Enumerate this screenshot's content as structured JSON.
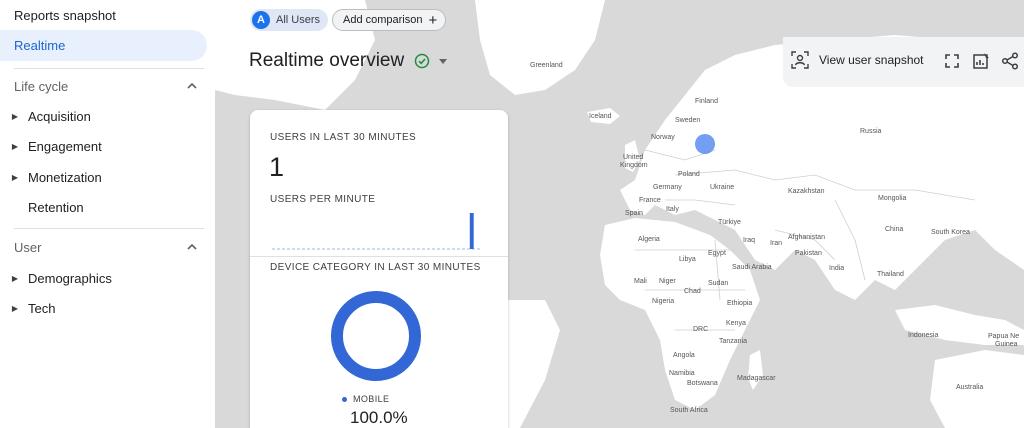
{
  "sidebar": {
    "reports_snapshot": "Reports snapshot",
    "realtime": "Realtime",
    "lifecycle": {
      "label": "Life cycle",
      "items": [
        "Acquisition",
        "Engagement",
        "Monetization",
        "Retention"
      ]
    },
    "user": {
      "label": "User",
      "items": [
        "Demographics",
        "Tech"
      ]
    }
  },
  "header": {
    "segment_badge": "A",
    "segment_label": "All Users",
    "add_comparison": "Add comparison",
    "title": "Realtime overview",
    "view_user_snapshot": "View user snapshot"
  },
  "card": {
    "users_label": "USERS IN LAST 30 MINUTES",
    "users_value": "1",
    "per_minute_label": "USERS PER MINUTE",
    "device_label": "DEVICE CATEGORY IN LAST 30 MINUTES",
    "device_series": "MOBILE",
    "device_value": "100.0%"
  },
  "map_labels": {
    "greenland": "Greenland",
    "iceland": "Iceland",
    "finland": "Finland",
    "sweden": "Sweden",
    "norway": "Norway",
    "russia": "Russia",
    "uk1": "United",
    "uk2": "Kingdom",
    "poland": "Poland",
    "germany": "Germany",
    "ukraine": "Ukraine",
    "france": "France",
    "kazakhstan": "Kazakhstan",
    "spain": "Spain",
    "italy": "Italy",
    "mongolia": "Mongolia",
    "turkiye": "Türkiye",
    "china": "China",
    "south_korea": "South Korea",
    "algeria": "Algeria",
    "libya": "Libya",
    "egypt": "Egypt",
    "iraq": "Iraq",
    "iran": "Iran",
    "afghanistan": "Afghanistan",
    "pakistan": "Pakistan",
    "saudi_arabia": "Saudi Arabia",
    "india": "India",
    "mali": "Mali",
    "niger": "Niger",
    "chad": "Chad",
    "sudan": "Sudan",
    "thailand": "Thailand",
    "nigeria": "Nigeria",
    "ethiopia": "Ethiopia",
    "drc": "DRC",
    "kenya": "Kenya",
    "tanzania": "Tanzania",
    "indonesia": "Indonesia",
    "papua1": "Papua Ne",
    "papua2": "Guinea",
    "angola": "Angola",
    "namibia": "Namibia",
    "madagascar": "Madagascar",
    "botswana": "Botswana",
    "australia": "Australia",
    "south_africa": "South Africa"
  },
  "colors": {
    "accent": "#1a73e8",
    "active_bg": "#e8f0fe",
    "active_text": "#1967d2",
    "chart_blue": "#3367d6",
    "map_land": "#ffffff",
    "map_water": "#d9d9d9",
    "user_dot": "#5b8def",
    "check_green": "#1e8e3e"
  },
  "icons": {
    "check": "check-circle-icon",
    "snapshot": "user-snapshot-icon",
    "fullscreen": "fullscreen-icon",
    "edit": "customize-report-icon",
    "share": "share-icon"
  },
  "chart_data": [
    {
      "type": "bar",
      "categories": [
        "Mobile"
      ],
      "series": [
        {
          "name": "MOBILE",
          "values": [
            100.0
          ]
        }
      ],
      "title": "DEVICE CATEGORY IN LAST 30 MINUTES"
    },
    {
      "type": "bar",
      "title": "USERS PER MINUTE",
      "values": [
        0,
        0,
        0,
        0,
        0,
        0,
        0,
        0,
        0,
        0,
        0,
        0,
        0,
        0,
        0,
        0,
        0,
        0,
        0,
        0,
        0,
        0,
        0,
        0,
        0,
        0,
        0,
        0,
        1,
        0
      ]
    }
  ]
}
